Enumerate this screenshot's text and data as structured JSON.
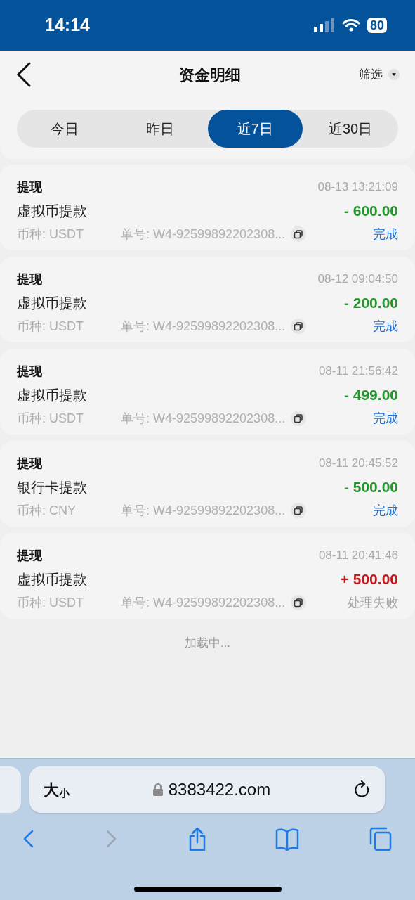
{
  "status_bar": {
    "time": "14:14",
    "battery": "80"
  },
  "header": {
    "title": "资金明细",
    "filter": "筛选"
  },
  "tabs": [
    {
      "label": "今日",
      "selected": false
    },
    {
      "label": "昨日",
      "selected": false
    },
    {
      "label": "近7日",
      "selected": true
    },
    {
      "label": "近30日",
      "selected": false
    }
  ],
  "records": [
    {
      "type": "提现",
      "time": "08-13 13:21:09",
      "method": "虚拟币提款",
      "amount": "- 600.00",
      "income": false,
      "currency": "币种: USDT",
      "order": "单号: W4-92599892202308...",
      "status": "完成",
      "failed": false
    },
    {
      "type": "提现",
      "time": "08-12 09:04:50",
      "method": "虚拟币提款",
      "amount": "- 200.00",
      "income": false,
      "currency": "币种: USDT",
      "order": "单号: W4-92599892202308...",
      "status": "完成",
      "failed": false
    },
    {
      "type": "提现",
      "time": "08-11 21:56:42",
      "method": "虚拟币提款",
      "amount": "- 499.00",
      "income": false,
      "currency": "币种: USDT",
      "order": "单号: W4-92599892202308...",
      "status": "完成",
      "failed": false
    },
    {
      "type": "提现",
      "time": "08-11 20:45:52",
      "method": "银行卡提款",
      "amount": "- 500.00",
      "income": false,
      "currency": "币种: CNY",
      "order": "单号: W4-92599892202308...",
      "status": "完成",
      "failed": false
    },
    {
      "type": "提现",
      "time": "08-11 20:41:46",
      "method": "虚拟币提款",
      "amount": "+ 500.00",
      "income": true,
      "currency": "币种: USDT",
      "order": "单号: W4-92599892202308...",
      "status": "处理失败",
      "failed": true
    }
  ],
  "loading": "加载中...",
  "browser": {
    "text_size": "大",
    "text_size_small": "小",
    "url": "8383422.com",
    "toolbar": [
      {
        "kind": "back",
        "disabled": false
      },
      {
        "kind": "forward",
        "disabled": true
      },
      {
        "kind": "share",
        "disabled": false
      },
      {
        "kind": "bookmarks",
        "disabled": false
      },
      {
        "kind": "tabs",
        "disabled": false
      }
    ]
  }
}
